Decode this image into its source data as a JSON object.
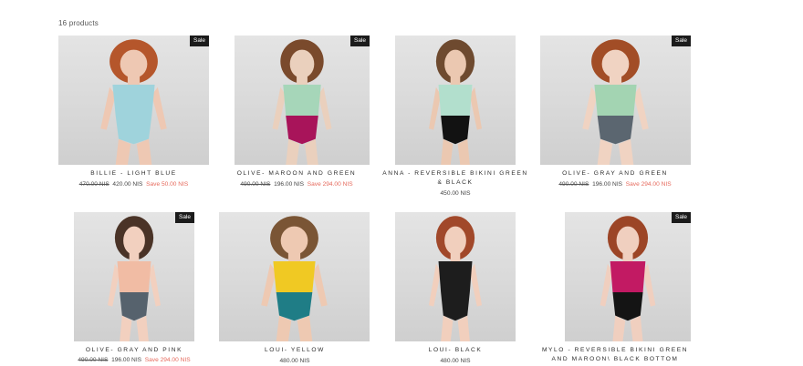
{
  "collection": {
    "product_count": "16 products",
    "sale_badge": "Sale"
  },
  "products": [
    {
      "title": "BILLIE - LIGHT BLUE",
      "old_price": "470.00 NIS",
      "price": "420.00 NIS",
      "save": "Save 50.00 NIS",
      "hair": "#b5562b",
      "skin": "#eec8b3",
      "suit_top": "#9fd3dc",
      "suit_bottom": "#9fd3dc"
    },
    {
      "title": "OLIVE- MAROON AND GREEN",
      "old_price": "490.00 NIS",
      "price": "196.00 NIS",
      "save": "Save 294.00 NIS",
      "hair": "#7a4a2c",
      "skin": "#ead0bd",
      "suit_top": "#a6d6b9",
      "suit_bottom": "#a8145a"
    },
    {
      "title": "ANNA - REVERSIBLE BIKINI GREEN & BLACK",
      "old_price": "",
      "price": "450.00 NIS",
      "save": "",
      "hair": "#6e4a2f",
      "skin": "#ebc8b1",
      "suit_top": "#b2dfcd",
      "suit_bottom": "#121212"
    },
    {
      "title": "OLIVE- GRAY AND GREEN",
      "old_price": "490.00 NIS",
      "price": "196.00 NIS",
      "save": "Save 294.00 NIS",
      "hair": "#a24d26",
      "skin": "#f0d3c2",
      "suit_top": "#a3d4b2",
      "suit_bottom": "#5b6670"
    },
    {
      "title": "OLIVE- GRAY AND PINK",
      "old_price": "490.00 NIS",
      "price": "196.00 NIS",
      "save": "Save 294.00 NIS",
      "hair": "#4a3327",
      "skin": "#f2d0bf",
      "suit_top": "#f1bca4",
      "suit_bottom": "#56626d"
    },
    {
      "title": "LOUI- YELLOW",
      "old_price": "",
      "price": "480.00 NIS",
      "save": "",
      "hair": "#7a5535",
      "skin": "#eec9b2",
      "suit_top": "#f0c923",
      "suit_bottom": "#1f7d86"
    },
    {
      "title": "LOUI- BLACK",
      "old_price": "",
      "price": "480.00 NIS",
      "save": "",
      "hair": "#a1482a",
      "skin": "#f1cfbd",
      "suit_top": "#1d1d1d",
      "suit_bottom": "#1d1d1d"
    },
    {
      "title": "MYLO - REVERSIBLE BIKINI GREEN AND MAROON\\ BLACK BOTTOM",
      "old_price": "",
      "price": "",
      "save": "",
      "hair": "#9c4526",
      "skin": "#f0cfbf",
      "suit_top": "#c21a63",
      "suit_bottom": "#141414"
    }
  ]
}
